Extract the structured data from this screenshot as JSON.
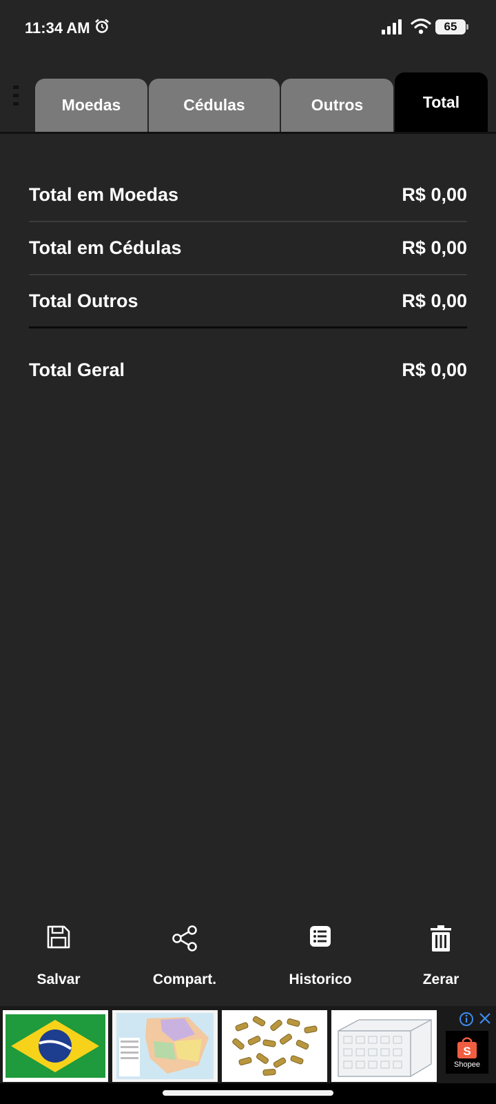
{
  "status_bar": {
    "time": "11:34 AM",
    "battery": "65",
    "icons": [
      "alarm-icon",
      "signal-icon",
      "wifi-icon",
      "battery-icon"
    ]
  },
  "tabs": [
    {
      "label": "Moedas",
      "active": false
    },
    {
      "label": "Cédulas",
      "active": false
    },
    {
      "label": "Outros",
      "active": false
    },
    {
      "label": "Total",
      "active": true
    }
  ],
  "totals": {
    "moedas": {
      "label": "Total em Moedas",
      "value": "R$ 0,00"
    },
    "cedulas": {
      "label": "Total em Cédulas",
      "value": "R$ 0,00"
    },
    "outros": {
      "label": "Total Outros",
      "value": "R$ 0,00"
    },
    "geral": {
      "label": "Total Geral",
      "value": "R$ 0,00"
    }
  },
  "toolbar": {
    "salvar": "Salvar",
    "compart": "Compart.",
    "historico": "Historico",
    "zerar": "Zerar"
  },
  "ad": {
    "brand": "Shopee",
    "icons": [
      "info-icon",
      "close-icon",
      "shopee-bag-icon"
    ]
  },
  "colors": {
    "background": "#252525",
    "tab_inactive": "#7a7a7a",
    "tab_active": "#000000",
    "text": "#ffffff"
  }
}
